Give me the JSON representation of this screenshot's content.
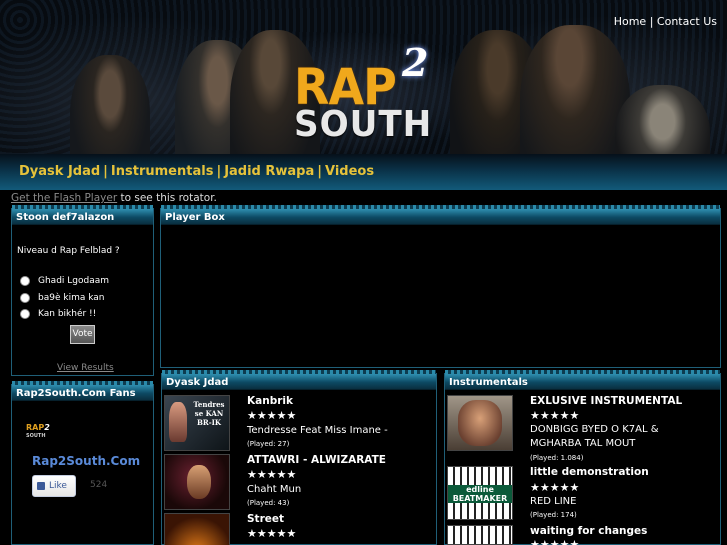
{
  "header": {
    "logo": {
      "rap": "RAP",
      "two": "2",
      "south": "SOUTH"
    },
    "top_links": {
      "home": "Home",
      "separator": "|",
      "contact": "Contact Us"
    },
    "nav": [
      {
        "label": "Dyask Jdad"
      },
      {
        "label": "Instrumentals"
      },
      {
        "label": "Jadid Rwapa"
      },
      {
        "label": "Videos"
      }
    ],
    "nav_separator": "|"
  },
  "flash_note": {
    "link": "Get the Flash Player",
    "text": " to see this rotator."
  },
  "poll": {
    "title": "Stoon def7alazon",
    "question": "Niveau d Rap Felblad ?",
    "options": [
      "Ghadi Lgodaam",
      "ba9è kima kan",
      "Kan bikhér !!"
    ],
    "vote_label": "Vote",
    "view_results": "View Results"
  },
  "player": {
    "title": "Player Box"
  },
  "fans": {
    "title": "Rap2South.Com Fans",
    "logo": {
      "rap": "RAP",
      "two": "2",
      "south": "SOUTH"
    },
    "name": "Rap2South.Com",
    "like_label": "Like",
    "like_count": "524"
  },
  "dyask": {
    "title": "Dyask Jdad",
    "thumb_text": "Tendresse KAN BR-IK",
    "tracks": [
      {
        "artist": "Kanbrik",
        "rating": "★★★★★",
        "song": "Tendresse Feat Miss Imane -",
        "played": "(Played: 27)"
      },
      {
        "artist": "ATTAWRI - ALWIZARATE",
        "rating": "★★★★★",
        "song": "Chaht Mun",
        "played": "(Played: 43)"
      },
      {
        "artist": "Street",
        "rating": "★★★★★",
        "song": "",
        "played": ""
      }
    ]
  },
  "instrumentals": {
    "title": "Instrumentals",
    "thumb_text": "edline BEATMAKER",
    "tracks": [
      {
        "artist": "EXLUSIVE INSTRUMENTAL",
        "rating": "★★★★★",
        "song": "DONBIGG BYED O K7AL &",
        "song2": "MGHARBA TAL MOUT",
        "played": "(Played: 1.084)"
      },
      {
        "artist": "little demonstration",
        "rating": "★★★★★",
        "song": "RED LINE",
        "played": "(Played: 174)"
      },
      {
        "artist": "waiting for changes",
        "rating": "★★★★★",
        "song": "",
        "played": ""
      }
    ]
  },
  "colors": {
    "nav_text": "#e6c23a",
    "logo_orange": "#f0a81c",
    "panel_head": "#0d4a64",
    "fans_name": "#5a8ad8"
  }
}
